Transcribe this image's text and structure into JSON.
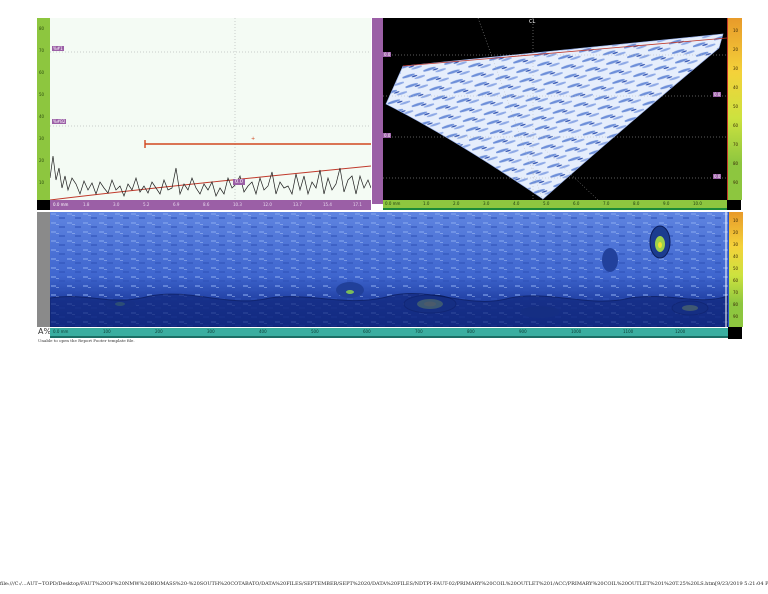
{
  "ascan": {
    "gate_a_label": "%#1",
    "gate_b_label": "%#B2",
    "cursor_value": "0.0",
    "cursor_mark": "+",
    "axis_start_label": "0.0 mm",
    "x_ticks": [
      "1.8",
      "3.0",
      "5.2",
      "6.9",
      "8.6",
      "10.3",
      "12.0",
      "13.7",
      "15.4",
      "17.1"
    ],
    "y_ticks": [
      "10",
      "20",
      "30",
      "40",
      "50",
      "60",
      "70",
      "80"
    ]
  },
  "sscan": {
    "cl_label": "CL",
    "markers": [
      "0.0",
      "0.0",
      "0.0",
      "0.0",
      "0.0"
    ],
    "axis_start_label": "0.0 mm",
    "x_ticks": [
      "1.0",
      "2.0",
      "3.0",
      "4.0",
      "5.0",
      "6.0",
      "7.0",
      "8.0",
      "9.0",
      "10.0"
    ],
    "right_ticks": [
      "10",
      "20",
      "30",
      "40",
      "50",
      "60",
      "70",
      "80",
      "90"
    ]
  },
  "cscan": {
    "corner_label": "A%",
    "axis_start_label": "0.0 mm",
    "x_ticks": [
      "100",
      "200",
      "300",
      "400",
      "500",
      "600",
      "700",
      "800",
      "900",
      "1000",
      "1100",
      "1200"
    ],
    "right_ticks": [
      "10",
      "20",
      "30",
      "40",
      "50",
      "60",
      "70",
      "80",
      "90"
    ]
  },
  "message": "Unable to open the Report Footer template file.",
  "footer_path": "file:///C:/...AUT~TOPD/Desktop/FAUT%20OF%20NMW%20BIOMASS%20-%20SOUTH%20COTABATO/DATA%20FILES/SEPTEMBER/SEPT%2020/DATA%20FILES/NDTPI-FAUT-02/PRIMARY%20COIL%20OUTLET%201/ACC/PRIMARY%20COIL%20OUTLET%201%20T.25%20LS.htm[9/23/2019 5:21:04 PM]",
  "colors": {
    "green_ruler": "#8dc63f",
    "purple_ruler": "#9b5fa6",
    "teal_bar": "#3aaea0",
    "ascan_bg": "#f4fbf4",
    "sscan_bg": "#000000",
    "cscan_base": "#4a6fd8"
  }
}
